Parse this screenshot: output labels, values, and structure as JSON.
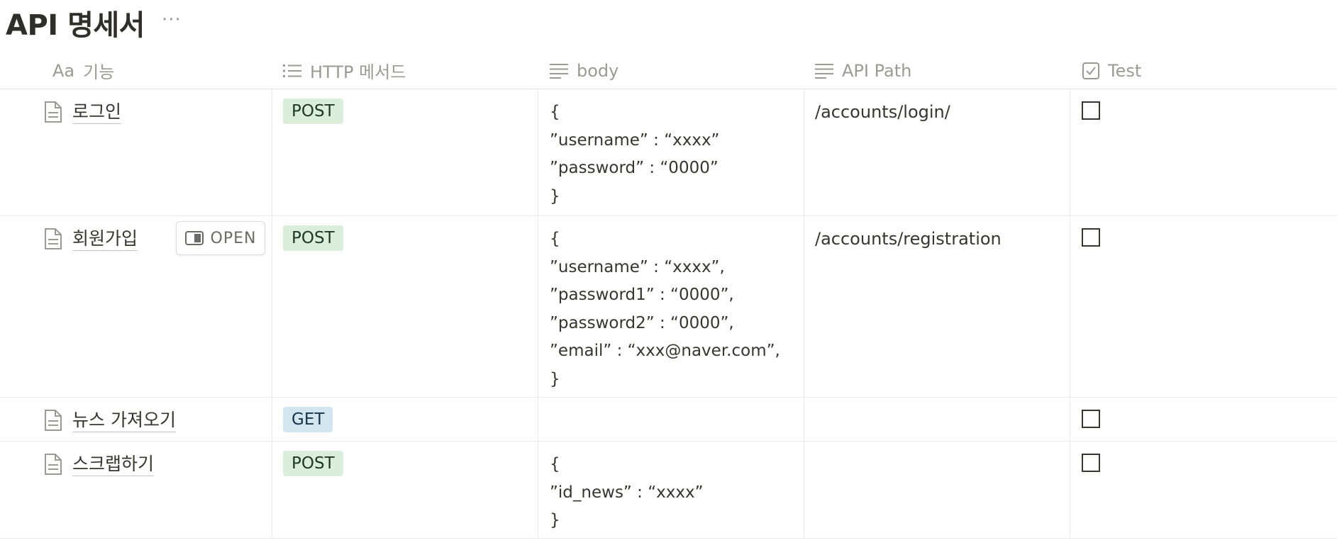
{
  "page": {
    "title": "API 명세서",
    "more_label": "···"
  },
  "columns": [
    {
      "label": "기능",
      "icon": "title-aa-icon",
      "icon_text": "Aa"
    },
    {
      "label": "HTTP 메서드",
      "icon": "list-icon"
    },
    {
      "label": "body",
      "icon": "text-lines-icon"
    },
    {
      "label": "API Path",
      "icon": "text-lines-icon"
    },
    {
      "label": "Test",
      "icon": "checkbox-icon"
    }
  ],
  "rows": [
    {
      "name": "로그인",
      "method": "POST",
      "body": "{\n”username” : “xxxx”\n”password” : “0000”\n}",
      "path": "/accounts/login/",
      "test": false
    },
    {
      "name": "회원가입",
      "open_label": "OPEN",
      "method": "POST",
      "body": "{\n”username” : “xxxx”,\n”password1” : “0000”,\n”password2” : “0000”,\n”email” : “xxx@naver.com”,\n}",
      "path": "/accounts/registration",
      "test": false
    },
    {
      "name": "뉴스 가져오기",
      "method": "GET",
      "body": "",
      "path": "",
      "test": false
    },
    {
      "name": "스크랩하기",
      "method": "POST",
      "body": "{\n”id_news” : “xxxx”\n}",
      "path": "",
      "test": false
    }
  ],
  "colors": {
    "post_tag_bg": "#dbeddb",
    "get_tag_bg": "#d3e5ef",
    "text": "#37352f",
    "muted": "#9b9a97"
  }
}
